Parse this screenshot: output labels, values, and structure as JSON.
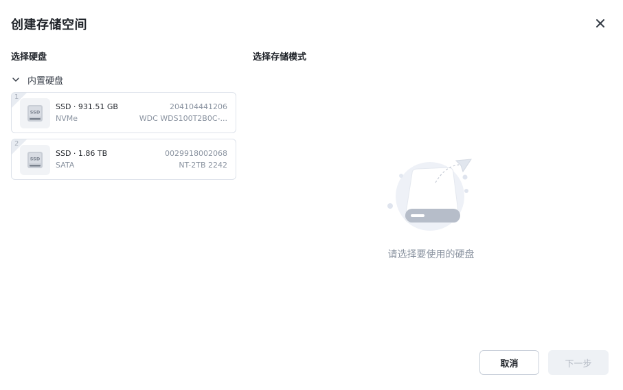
{
  "dialog": {
    "title": "创建存储空间",
    "close_icon": "close-icon"
  },
  "left_panel": {
    "label": "选择硬盘",
    "group": {
      "label": "内置硬盘",
      "icon": "chevron-down-icon",
      "expanded": true
    },
    "disks": [
      {
        "slot": "1",
        "name": "SSD · 931.51 GB",
        "interface": "NVMe",
        "serial": "204104441206",
        "model": "WDC WDS100T2B0C-...",
        "icon": "ssd-icon"
      },
      {
        "slot": "2",
        "name": "SSD · 1.86 TB",
        "interface": "SATA",
        "serial": "0029918002068",
        "model": "NT-2TB 2242",
        "icon": "ssd-icon"
      }
    ]
  },
  "right_panel": {
    "label": "选择存储模式",
    "empty_state": {
      "icon": "empty-disk-illustration",
      "text": "请选择要使用的硬盘"
    }
  },
  "footer": {
    "cancel_label": "取消",
    "next_label": "下一步",
    "next_enabled": false
  },
  "colors": {
    "border": "#dde2ea",
    "muted_text": "#8a93a0",
    "disabled_bg": "#eef1f5"
  }
}
